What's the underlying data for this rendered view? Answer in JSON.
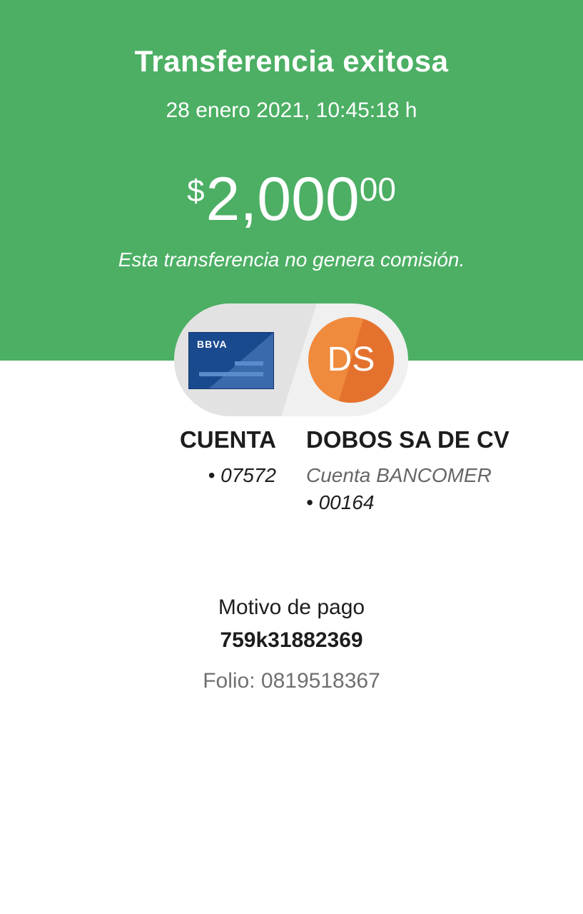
{
  "header": {
    "title": "Transferencia exitosa",
    "datetime": "28 enero 2021, 10:45:18 h",
    "amount": {
      "currency_symbol": "$",
      "integer": "2,000",
      "decimals": "00"
    },
    "commission_note": "Esta transferencia no genera comisión."
  },
  "colors": {
    "header_green": "#4caf64",
    "card_blue": "#1a4a8e",
    "avatar_orange": "#f08a3c"
  },
  "origin": {
    "card_brand": "BBVA",
    "card_icon": "bank-card-icon",
    "title": "CUENTA",
    "account": "• 07572"
  },
  "destination": {
    "initials": "DS",
    "title": "DOBOS SA DE CV",
    "bank": "Cuenta BANCOMER",
    "account": "• 00164"
  },
  "details": {
    "motivo_label": "Motivo de pago",
    "motivo_value": "759k31882369",
    "folio": "Folio: 0819518367"
  }
}
